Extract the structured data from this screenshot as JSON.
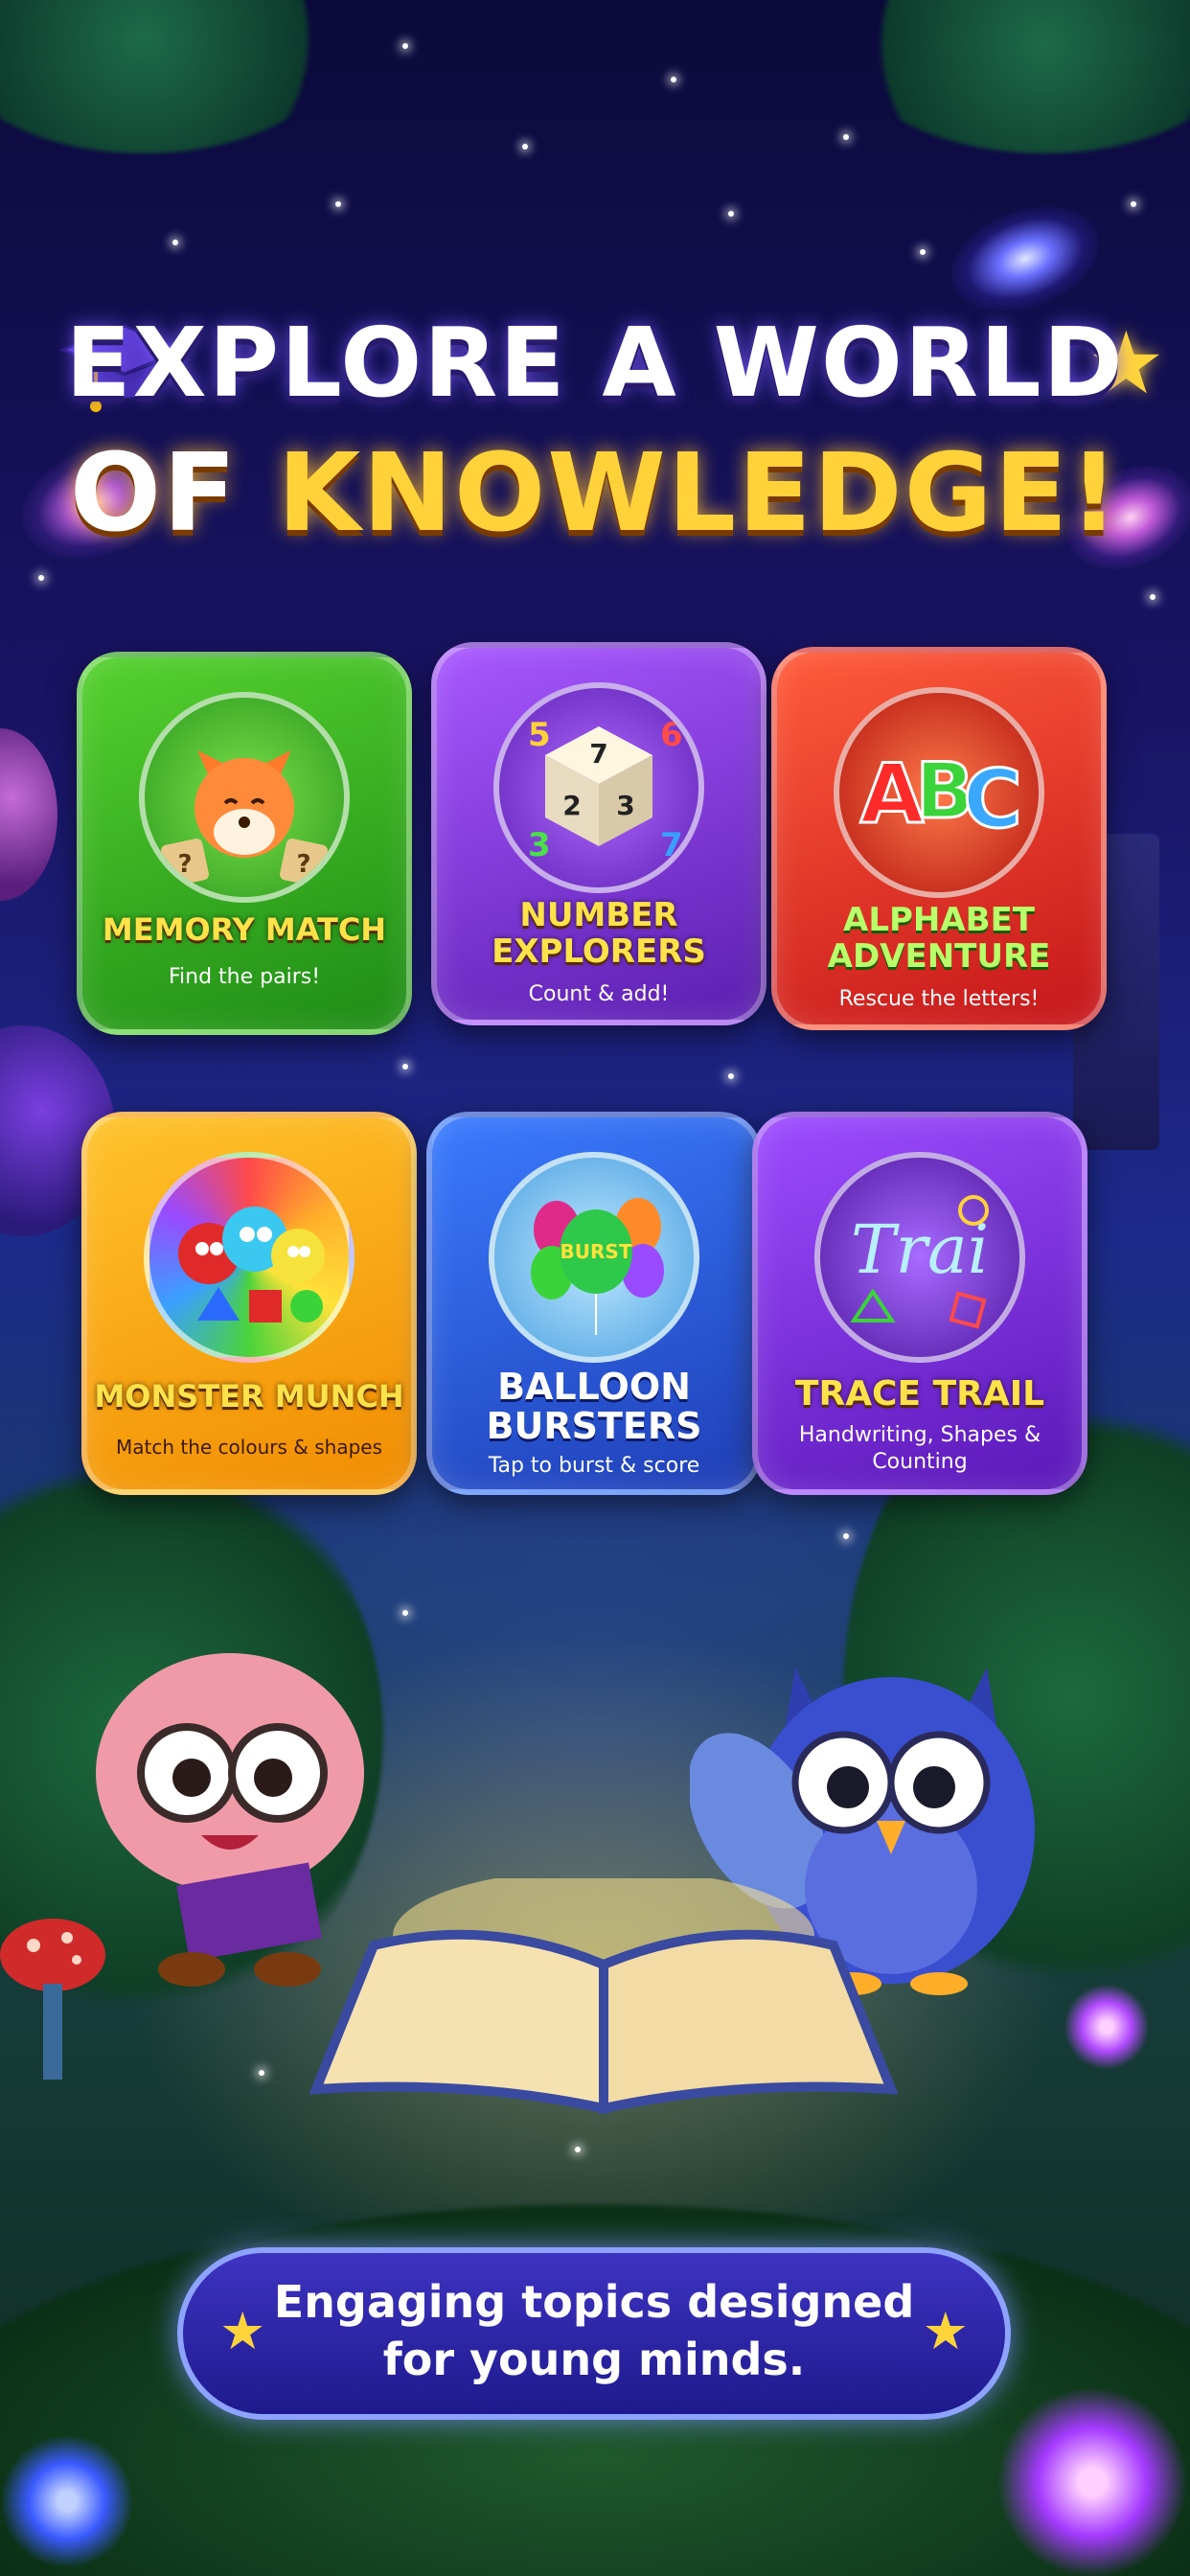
{
  "header": {
    "title_line1": "EXPLORE A WORLD",
    "title_line2_prefix": "OF ",
    "title_line2_highlight": "KNOWLEDGE!",
    "icons": [
      "graduation-cap-icon",
      "star-icon"
    ]
  },
  "games": [
    {
      "title_line1": "MEMORY MATCH",
      "title_line2": "",
      "subtitle_line1": "Find the pairs!",
      "subtitle_line2": "",
      "icon": "fox-icon",
      "color": "#3fb320"
    },
    {
      "title_line1": "NUMBER",
      "title_line2": "EXPLORERS",
      "subtitle_line1": "Count & add!",
      "subtitle_line2": "",
      "icon": "dice-icon",
      "color": "#7a3ae0"
    },
    {
      "title_line1": "ALPHABET",
      "title_line2": "ADVENTURE",
      "subtitle_line1": "Rescue the letters!",
      "subtitle_line2": "",
      "icon": "abc-letters-icon",
      "color": "#e0321f"
    },
    {
      "title_line1": "MONSTER MUNCH",
      "title_line2": "",
      "subtitle_line1": "Match the colours & shapes",
      "subtitle_line2": "",
      "icon": "monsters-icon",
      "color": "#f5a20f"
    },
    {
      "title_line1": "BALLOON",
      "title_line2": "BURSTERS",
      "subtitle_line1": "Tap to burst & score",
      "subtitle_line2": "",
      "icon": "balloons-icon",
      "color": "#2e5ce0"
    },
    {
      "title_line1": "TRACE TRAIL",
      "title_line2": "",
      "subtitle_line1": "Handwriting, Shapes &",
      "subtitle_line2": "Counting",
      "icon": "trace-icon",
      "color": "#7a2fe0"
    }
  ],
  "game_art_text": {
    "numbers": [
      "5",
      "6",
      "3",
      "7"
    ],
    "dice_faces": [
      "7",
      "2",
      "3"
    ],
    "letters": [
      "A",
      "B",
      "C"
    ],
    "balloon_label": "BURST",
    "trace_word": "Trai"
  },
  "footer": {
    "line1": "Engaging topics designed",
    "line2": "for young minds."
  },
  "colors": {
    "title_white": "#ffffff",
    "title_gold": "#ffd23a",
    "banner": "#2a25a8"
  }
}
